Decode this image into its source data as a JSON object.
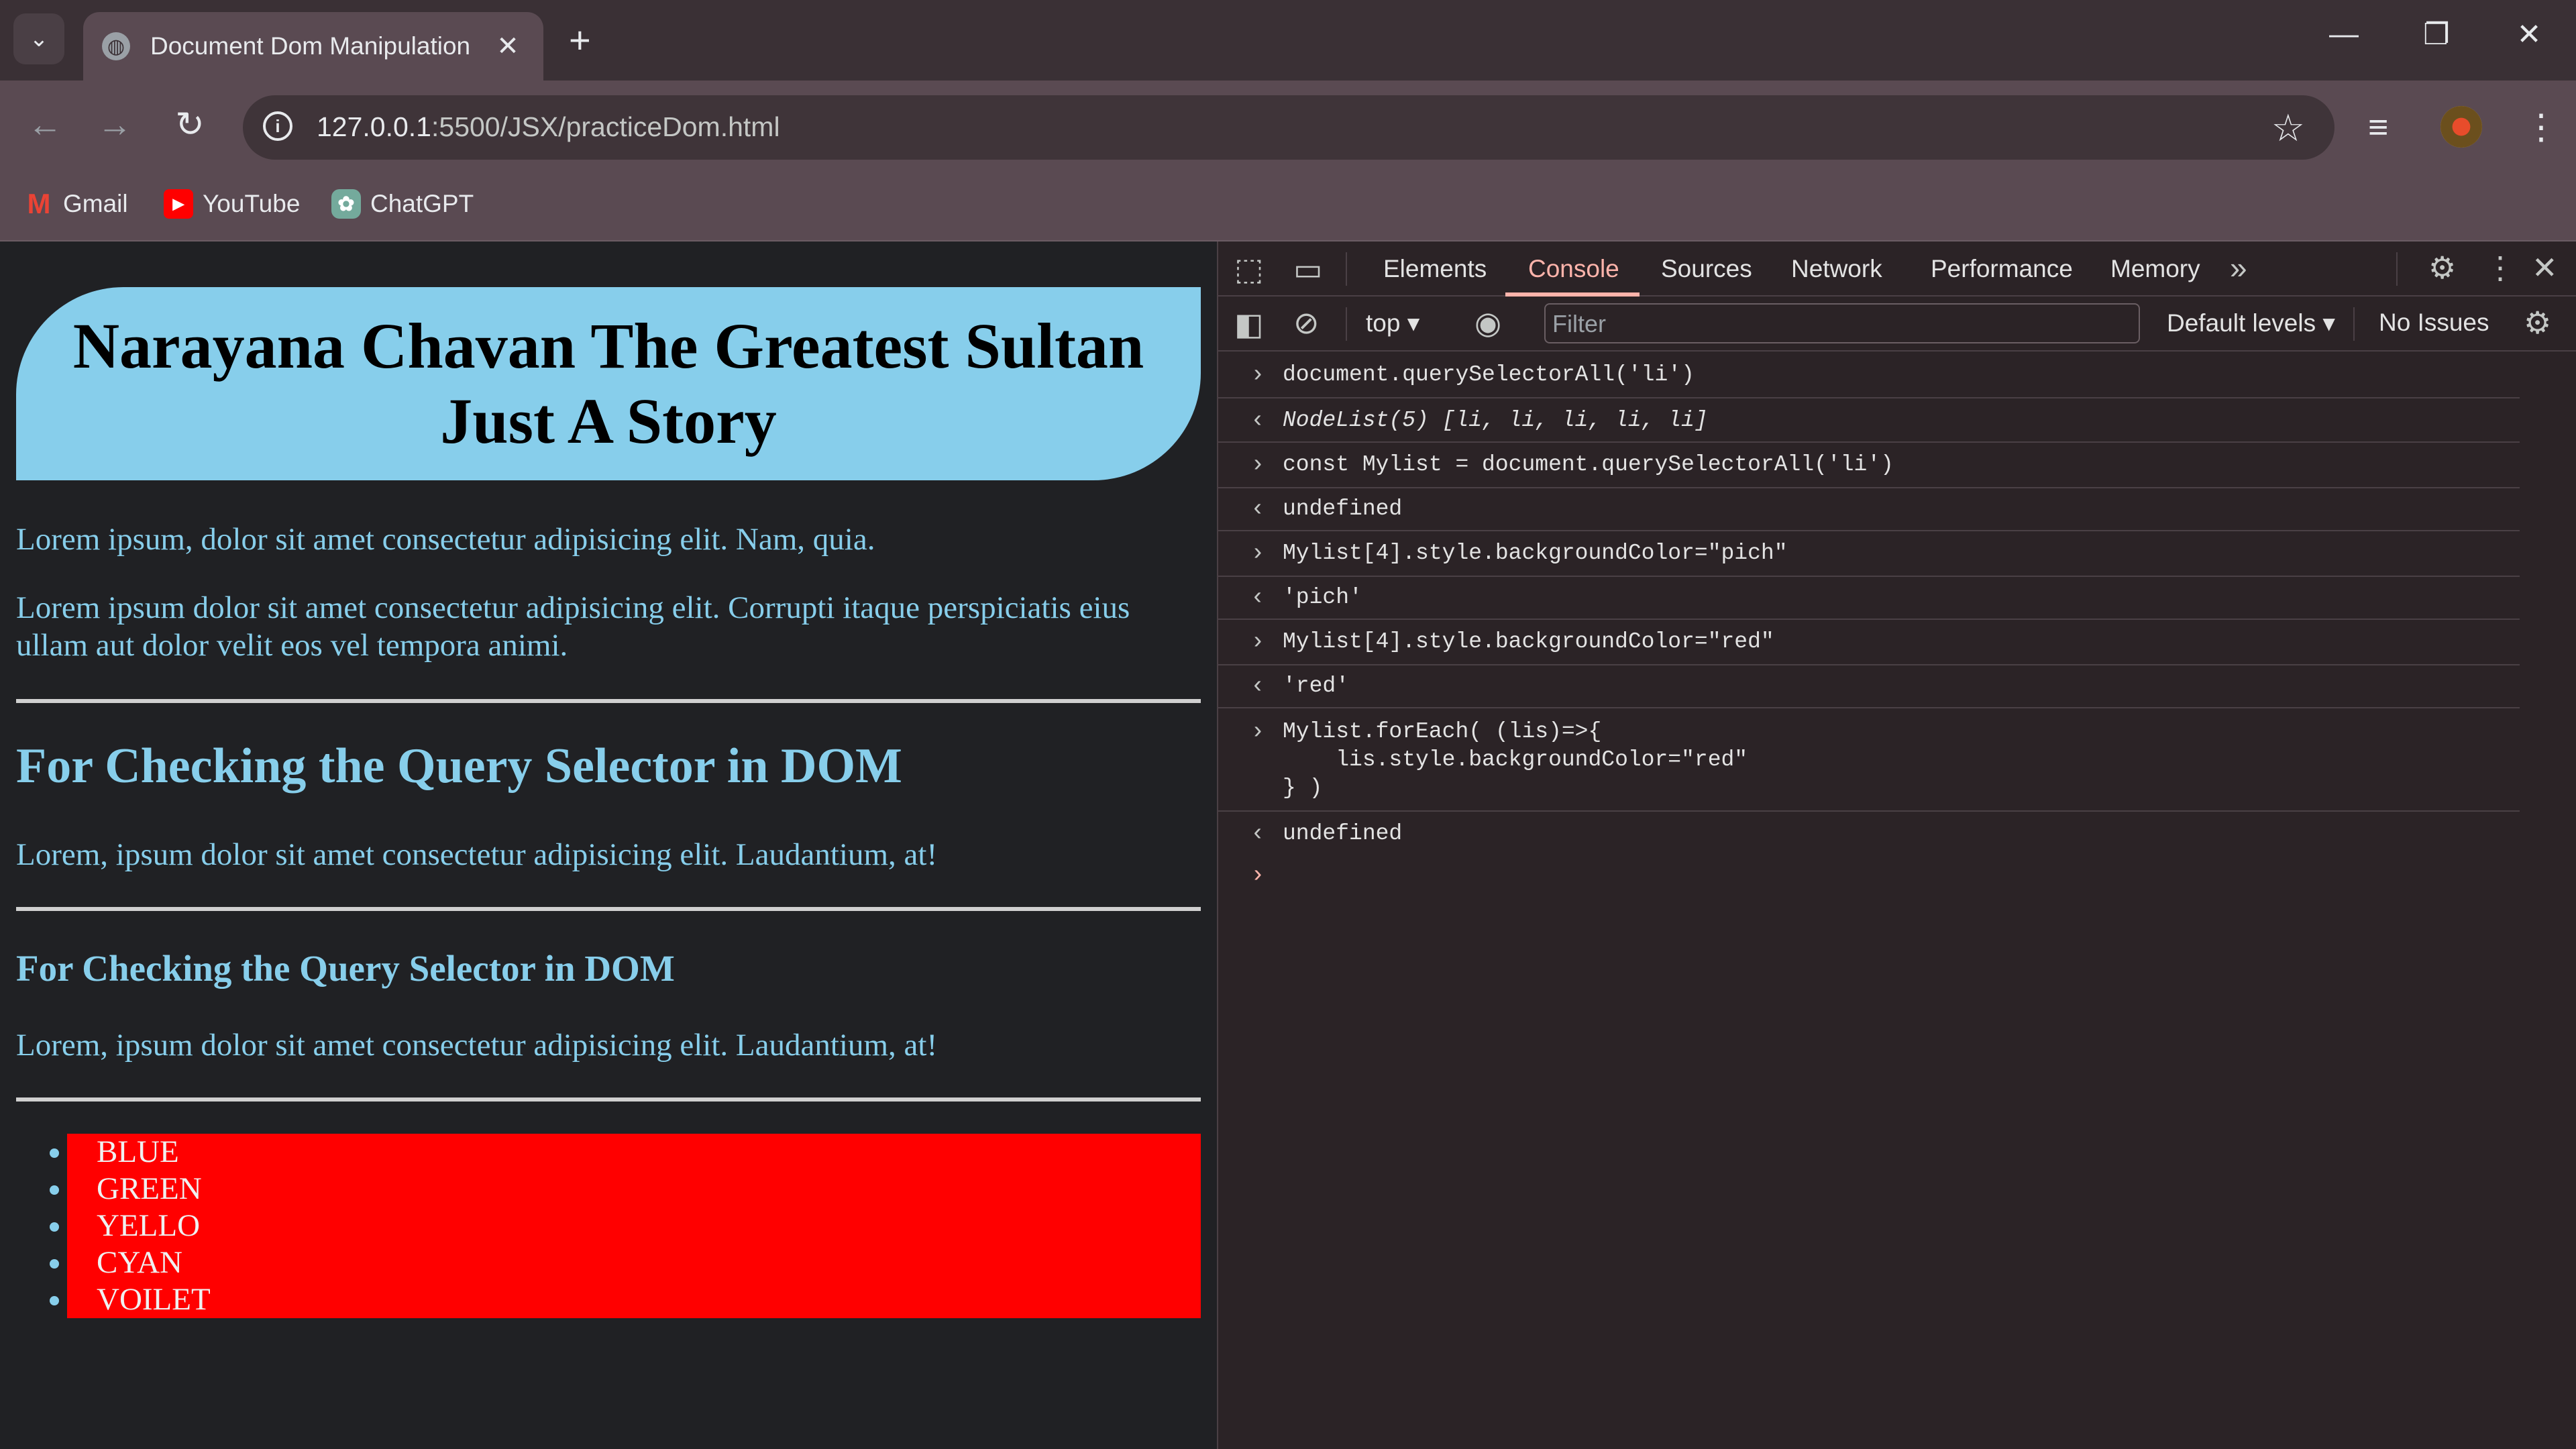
{
  "browser": {
    "tab_title": "Document Dom Manipulation",
    "url_host": "127.0.0.1",
    "url_path": ":5500/JSX/practiceDom.html",
    "bookmarks": [
      {
        "label": "Gmail",
        "icon": "gmail-icon"
      },
      {
        "label": "YouTube",
        "icon": "youtube-icon"
      },
      {
        "label": "ChatGPT",
        "icon": "chatgpt-icon"
      }
    ]
  },
  "page": {
    "banner_title": "Narayana Chavan The Greatest Sultan Just A Story",
    "para1": "Lorem ipsum, dolor sit amet consectetur adipisicing elit. Nam, quia.",
    "para2": "Lorem ipsum dolor sit amet consectetur adipisicing elit. Corrupti itaque perspiciatis eius ullam aut dolor velit eos vel tempora animi.",
    "heading2": "For Checking the Query Selector in DOM",
    "para3": "Lorem, ipsum dolor sit amet consectetur adipisicing elit. Laudantium, at!",
    "heading3": "For Checking the Query Selector in DOM",
    "para4": "Lorem, ipsum dolor sit amet consectetur adipisicing elit. Laudantium, at!",
    "list_items": [
      "BLUE",
      "GREEN",
      "YELLO",
      "CYAN",
      "VOILET"
    ],
    "list_bg_color": "#ff0000"
  },
  "devtools": {
    "tabs": [
      "Elements",
      "Console",
      "Sources",
      "Network",
      "Performance",
      "Memory"
    ],
    "active_tab": "Console",
    "context": "top",
    "filter_placeholder": "Filter",
    "levels": "Default levels",
    "issues": "No Issues",
    "console": {
      "l1": "document.querySelectorAll('li')",
      "l2": "NodeList(5) [li, li, li, li, li]",
      "l3": "const Mylist = document.querySelectorAll('li')",
      "l4": "undefined",
      "l5": "Mylist[4].style.backgroundColor=\"pich\"",
      "l6": "'pich'",
      "l7": "Mylist[4].style.backgroundColor=\"red\"",
      "l8": "'red'",
      "l9a": "Mylist.forEach( (lis)=>{",
      "l9b": "    lis.style.backgroundColor=\"red\"",
      "l9c": "} )",
      "l10": "undefined"
    }
  }
}
